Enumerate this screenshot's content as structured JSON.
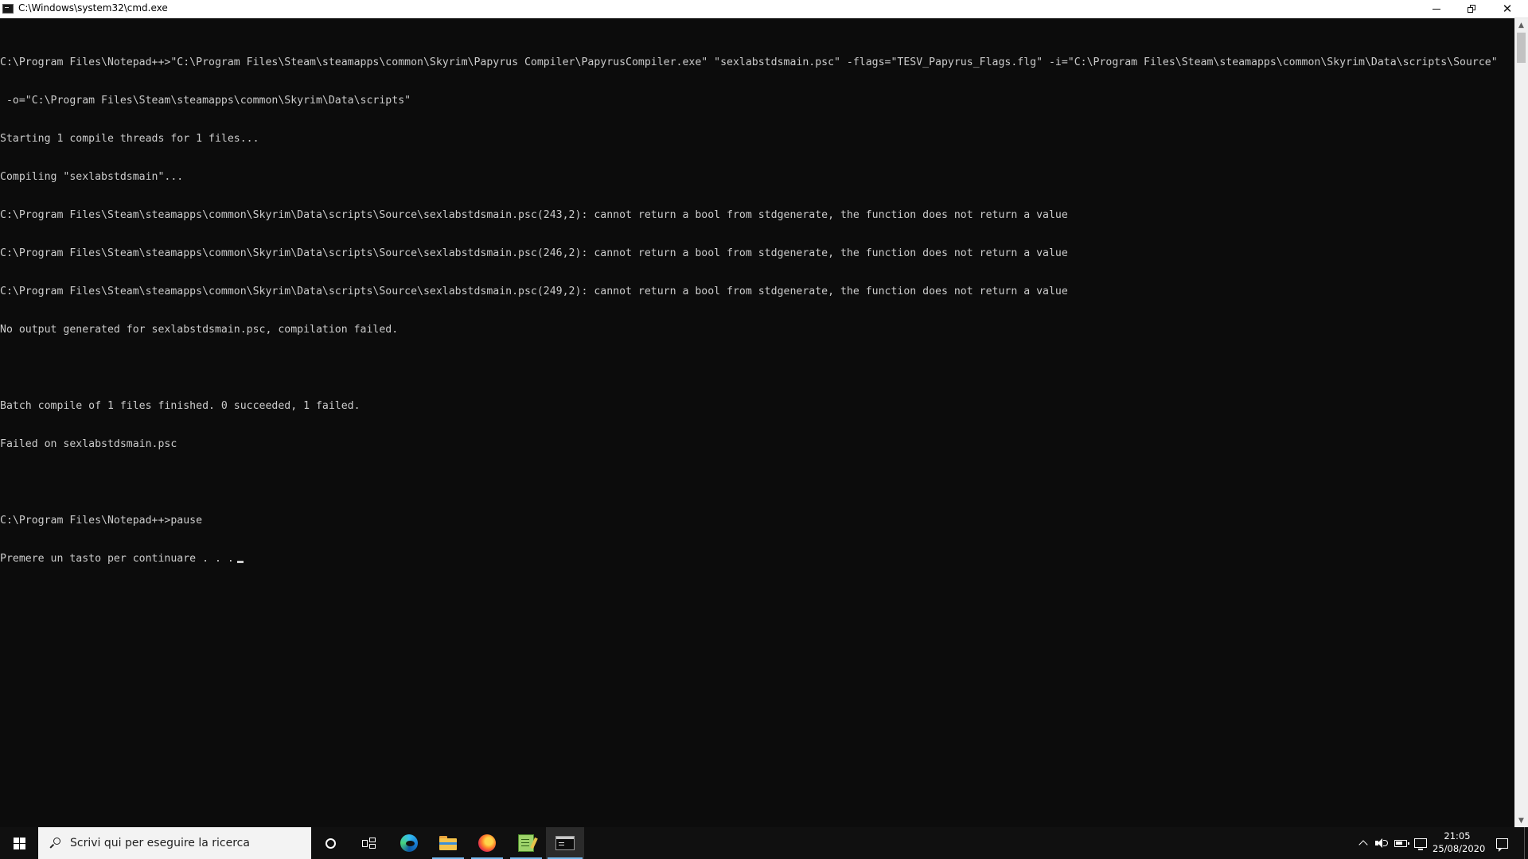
{
  "window": {
    "title": "C:\\Windows\\system32\\cmd.exe",
    "minimize_label": "",
    "restore_label": "",
    "close_label": "✕"
  },
  "console": {
    "lines": [
      "C:\\Program Files\\Notepad++>\"C:\\Program Files\\Steam\\steamapps\\common\\Skyrim\\Papyrus Compiler\\PapyrusCompiler.exe\" \"sexlabstdsmain.psc\" -flags=\"TESV_Papyrus_Flags.flg\" -i=\"C:\\Program Files\\Steam\\steamapps\\common\\Skyrim\\Data\\scripts\\Source\"",
      " -o=\"C:\\Program Files\\Steam\\steamapps\\common\\Skyrim\\Data\\scripts\"",
      "Starting 1 compile threads for 1 files...",
      "Compiling \"sexlabstdsmain\"...",
      "C:\\Program Files\\Steam\\steamapps\\common\\Skyrim\\Data\\scripts\\Source\\sexlabstdsmain.psc(243,2): cannot return a bool from stdgenerate, the function does not return a value",
      "C:\\Program Files\\Steam\\steamapps\\common\\Skyrim\\Data\\scripts\\Source\\sexlabstdsmain.psc(246,2): cannot return a bool from stdgenerate, the function does not return a value",
      "C:\\Program Files\\Steam\\steamapps\\common\\Skyrim\\Data\\scripts\\Source\\sexlabstdsmain.psc(249,2): cannot return a bool from stdgenerate, the function does not return a value",
      "No output generated for sexlabstdsmain.psc, compilation failed.",
      "",
      "Batch compile of 1 files finished. 0 succeeded, 1 failed.",
      "Failed on sexlabstdsmain.psc",
      "",
      "C:\\Program Files\\Notepad++>pause",
      "Premere un tasto per continuare . . ."
    ]
  },
  "taskbar": {
    "search_placeholder": "Scrivi qui per eseguire la ricerca",
    "icons": [
      "windows-start-icon",
      "search-icon",
      "cortana-icon",
      "task-view-icon",
      "edge-icon",
      "file-explorer-icon",
      "firefox-icon",
      "notepad-plus-plus-icon",
      "command-prompt-icon"
    ],
    "time": "21:05",
    "date": "25/08/2020"
  },
  "colors": {
    "console_bg": "#0c0c0c",
    "console_fg": "#cccccc",
    "taskbar_bg": "#101010",
    "accent": "#76b9ed"
  }
}
